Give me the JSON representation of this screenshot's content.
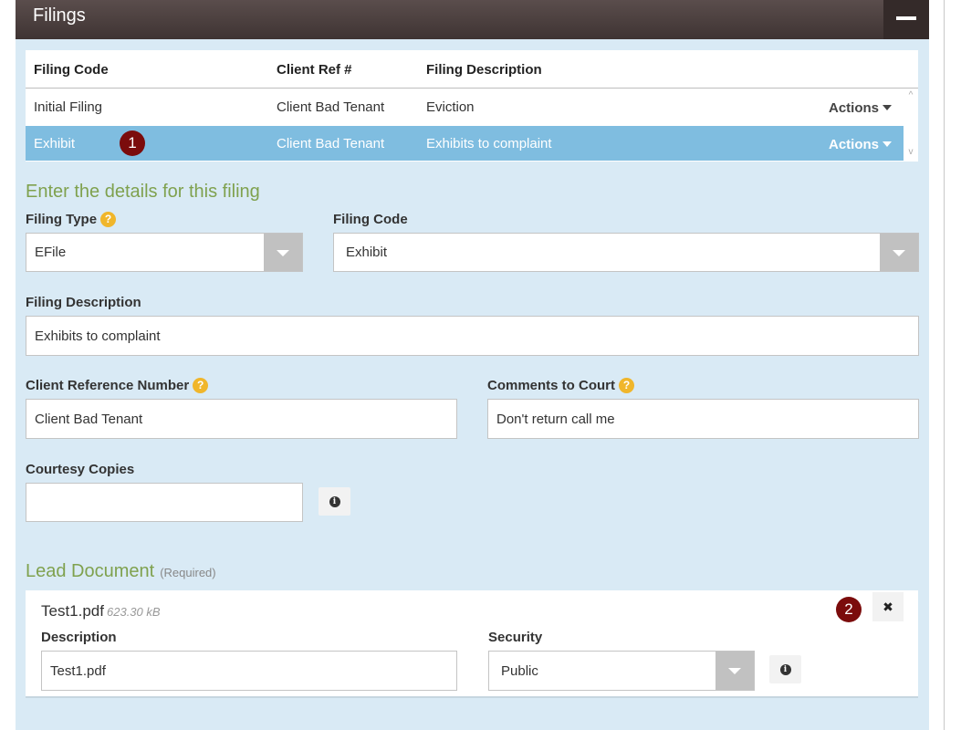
{
  "panel": {
    "title": "Filings"
  },
  "grid": {
    "headers": [
      "Filing Code",
      "Client Ref #",
      "Filing Description"
    ],
    "rows": [
      {
        "code": "Initial Filing",
        "ref": "Client Bad Tenant",
        "desc": "Eviction",
        "actions": "Actions"
      },
      {
        "code": "Exhibit",
        "ref": "Client Bad Tenant",
        "desc": "Exhibits to complaint",
        "actions": "Actions"
      }
    ]
  },
  "markers": [
    "1",
    "2"
  ],
  "details": {
    "heading": "Enter the details for this filing",
    "filing_type": {
      "label": "Filing Type",
      "value": "EFile"
    },
    "filing_code": {
      "label": "Filing Code",
      "value": "Exhibit"
    },
    "filing_description": {
      "label": "Filing Description",
      "value": "Exhibits to complaint"
    },
    "client_ref": {
      "label": "Client Reference Number",
      "value": "Client Bad Tenant"
    },
    "comments": {
      "label": "Comments to Court",
      "value": "Don't return call me"
    },
    "courtesy": {
      "label": "Courtesy Copies",
      "value": ""
    }
  },
  "lead_doc": {
    "heading": "Lead Document",
    "required": "(Required)",
    "file_name": "Test1.pdf",
    "file_size": "623.30 kB",
    "description": {
      "label": "Description",
      "value": "Test1.pdf"
    },
    "security": {
      "label": "Security",
      "value": "Public"
    }
  },
  "icons": {
    "help": "?",
    "info": "i",
    "remove": "✖",
    "scroll_up": "^",
    "scroll_down": "v"
  }
}
